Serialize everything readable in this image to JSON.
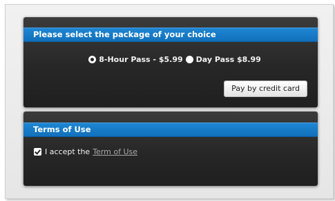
{
  "package_section": {
    "header": "Please select the package of your choice",
    "options": [
      {
        "label": "8-Hour Pass - $5.99",
        "selected": true
      },
      {
        "label": "Day Pass $8.99",
        "selected": false
      }
    ],
    "pay_button_label": "Pay by credit card"
  },
  "terms_section": {
    "header": "Terms of Use",
    "accept_checked": true,
    "accept_text": "I accept the",
    "link_text": "Term of Use"
  },
  "colors": {
    "header_blue": "#1a7ecb",
    "panel_dark": "#2a2a2a"
  }
}
